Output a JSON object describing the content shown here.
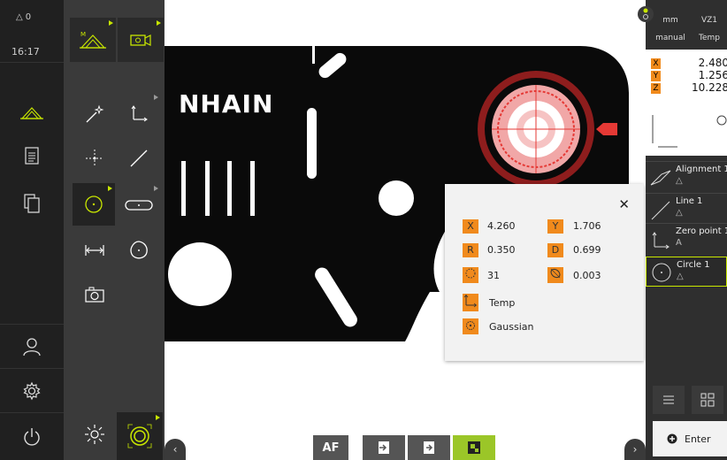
{
  "mainbar": {
    "message_count": "0",
    "time": "16:17"
  },
  "view": {
    "logo_text": "NHAIN"
  },
  "popup": {
    "x_label": "X",
    "x_value": "4.260",
    "y_label": "Y",
    "y_value": "1.706",
    "r_label": "R",
    "r_value": "0.350",
    "d_label": "D",
    "d_value": "0.699",
    "points_value": "31",
    "form_value": "0.003",
    "reference": "Temp",
    "filter": "Gaussian"
  },
  "inspector": {
    "unit": "mm",
    "coord_system": "VZ1",
    "mode": "manual",
    "preset": "Temp",
    "x_label": "X",
    "x_value": "2.480",
    "y_label": "Y",
    "y_value": "1.256",
    "z_label": "Z",
    "z_value": "10.228",
    "features": [
      {
        "name": "Alignment 1",
        "symbol": "△"
      },
      {
        "name": "Line 1",
        "symbol": "△"
      },
      {
        "name": "Zero point 1",
        "symbol": "A"
      },
      {
        "name": "Circle 1",
        "symbol": "△"
      }
    ],
    "enter_label": "Enter"
  },
  "bottom": {
    "af_label": "AF"
  },
  "colors": {
    "accent": "#c8e600",
    "orange": "#f08a1c",
    "dark": "#202020"
  }
}
